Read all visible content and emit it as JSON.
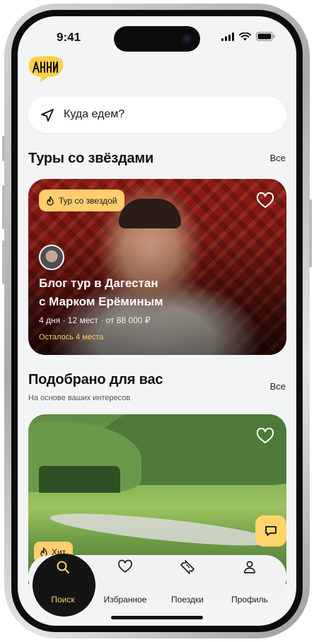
{
  "status_bar": {
    "time": "9:41"
  },
  "logo": {
    "text": "АННИ"
  },
  "search": {
    "placeholder": "Куда едем?"
  },
  "stars_section": {
    "title": "Туры со звёздами",
    "all_label": "Все",
    "card": {
      "badge": "Тур со звездой",
      "title_line1": "Блог тур в Дагестан",
      "title_line2": "с Марком Ерёминым",
      "meta": "4 дня · 12 мест · от 88 000 ₽",
      "availability": "Осталось 4 места"
    }
  },
  "picked_section": {
    "title": "Подобрано для вас",
    "subtitle": "На основе ваших интересов",
    "all_label": "Все",
    "card": {
      "badge": "Хит"
    }
  },
  "tabbar": {
    "tabs": [
      {
        "label": "Поиск",
        "active": true
      },
      {
        "label": "Избранное",
        "active": false
      },
      {
        "label": "Поездки",
        "active": false
      },
      {
        "label": "Профиль",
        "active": false
      }
    ]
  },
  "colors": {
    "accent": "#ffce6d",
    "background": "#f3f4f6",
    "tab_active": "#141414",
    "accent_text": "#ffcd5c"
  },
  "icons": [
    "location-arrow-icon",
    "heart-icon",
    "flame-icon",
    "chat-icon",
    "search-icon",
    "ticket-icon",
    "person-icon"
  ]
}
